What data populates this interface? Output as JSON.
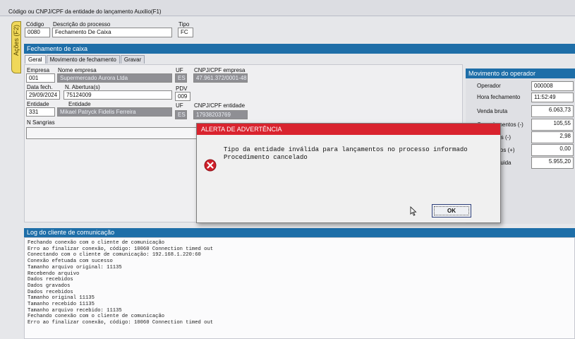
{
  "header": {
    "title": "Código ou CNPJ/CPF da entidade do lançamento Auxilio(F1)",
    "codigo_label": "Código",
    "codigo_value": "0080",
    "descricao_label": "Descrição do processo",
    "descricao_value": "Fechamento De Caixa",
    "tipo_label": "Tipo",
    "tipo_value": "FC"
  },
  "side_tab": {
    "label": "Ações (F2)"
  },
  "section": {
    "title": "Fechamento de caixa"
  },
  "tabs": [
    {
      "label": "Geral"
    },
    {
      "label": "Movimento de fechamento"
    },
    {
      "label": "Gravar"
    }
  ],
  "form": {
    "empresa_label": "Empresa",
    "empresa_value": "001",
    "nome_empresa_label": "Nome empresa",
    "nome_empresa_value": "Supermercado Aurora Ltda",
    "uf_label": "UF",
    "uf_value": "ES",
    "cnpj_label": "CNPJ/CPF empresa",
    "cnpj_value": "47.961.372/0001-48",
    "data_fech_label": "Data fech.",
    "data_fech_value": "29/09/2024",
    "abertura_label": "N. Abertura(s)",
    "abertura_value": "75124009",
    "pdv_label": "PDV",
    "pdv_value": "009",
    "entidade_label": "Entidade",
    "entidade_value": "331",
    "entidade_nome_label": "Entidade",
    "entidade_nome_value": "Mikael Patryck Fidelis Ferreira",
    "ent_uf_label": "UF",
    "ent_uf_value": "ES",
    "ent_cnpj_label": "CNPJ/CPF entidade",
    "ent_cnpj_value": "17938203769",
    "sangrias_label": "N Sangrias"
  },
  "operator": {
    "title": "Movimento do operador",
    "rows": [
      {
        "label": "Operador",
        "value": "000008"
      },
      {
        "label": "Hora fechamento",
        "value": "11:52:49"
      },
      {
        "label": "Venda bruta",
        "value": "6.063,73"
      },
      {
        "label": "Cancelamentos (-)",
        "value": "105,55"
      },
      {
        "label": "Descontos (-)",
        "value": "2,98"
      },
      {
        "label": "Acréscimos (+)",
        "value": "0,00"
      },
      {
        "label": "Venda líquida",
        "value": "5.955,20"
      }
    ]
  },
  "log": {
    "title": "Log do cliente de comunicação",
    "lines": [
      "Fechando conexão com o cliente de comunicação",
      "Erro ao finalizar conexão, código: 10060 Connection timed out",
      "Conectando com o cliente de comunicação: 192.168.1.220:60",
      "Conexão efetuada com sucesso",
      "Tamanho arquivo original: 11135",
      "Recebendo arquivo",
      "Dados recebidos",
      "Dados gravados",
      "Dados recebidos",
      "Tamanho original 11135",
      "Tamanho recebido 11135",
      "Tamanho arquivo recebido: 11135",
      "Fechando conexão com o cliente de comunicação",
      "Erro ao finalizar conexão, código: 10060 Connection timed out"
    ]
  },
  "dialog": {
    "title": "ALERTA DE ADVERTÊNCIA",
    "message_line1": "Tipo da entidade inválida para lançamentos no processo informado",
    "message_line2": "Procedimento cancelado",
    "ok_label": "OK",
    "icon": "error-icon"
  },
  "colors": {
    "accent_blue": "#1e6ea8",
    "alert_red": "#d9232e",
    "tab_yellow": "#f0d85a"
  }
}
